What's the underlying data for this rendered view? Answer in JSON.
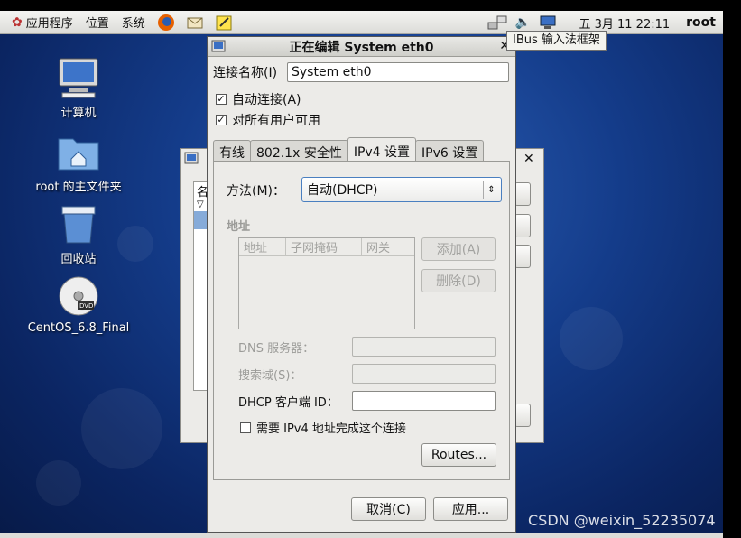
{
  "top_panel": {
    "menu": [
      "应用程序",
      "位置",
      "系统"
    ],
    "clock": "五 3月 11 22:11",
    "user": "root"
  },
  "tooltip": "IBus 输入法框架",
  "desktop_icons": [
    {
      "label": "计算机",
      "icon": "computer-icon"
    },
    {
      "label": "root 的主文件夹",
      "icon": "home-folder-icon"
    },
    {
      "label": "回收站",
      "icon": "trash-icon"
    },
    {
      "label": "CentOS_6.8_Final",
      "icon": "dvd-icon"
    }
  ],
  "background_dialog": {
    "partial_text": "名"
  },
  "dialog": {
    "title": "正在编辑 System eth0",
    "connection_name_label": "连接名称(I)",
    "connection_name_value": "System eth0",
    "auto_connect_label": "自动连接(A)",
    "auto_connect_checked": true,
    "all_users_label": "对所有用户可用",
    "all_users_checked": true,
    "tabs": [
      "有线",
      "802.1x 安全性",
      "IPv4 设置",
      "IPv6 设置"
    ],
    "active_tab": "IPv4 设置",
    "method_label": "方法(M)：",
    "method_value": "自动(DHCP)",
    "address_section_label": "地址",
    "address_columns": [
      "地址",
      "子网掩码",
      "网关"
    ],
    "add_button": "添加(A)",
    "delete_button": "删除(D)",
    "dns_label": "DNS 服务器：",
    "search_domain_label": "搜索域(S)：",
    "dhcp_client_id_label": "DHCP 客户端 ID：",
    "dhcp_client_id_value": "",
    "require_ipv4_label": "需要 IPv4 地址完成这个连接",
    "require_ipv4_checked": false,
    "routes_button": "Routes...",
    "cancel_button": "取消(C)",
    "apply_button": "应用..."
  },
  "watermark": "CSDN @weixin_52235074"
}
